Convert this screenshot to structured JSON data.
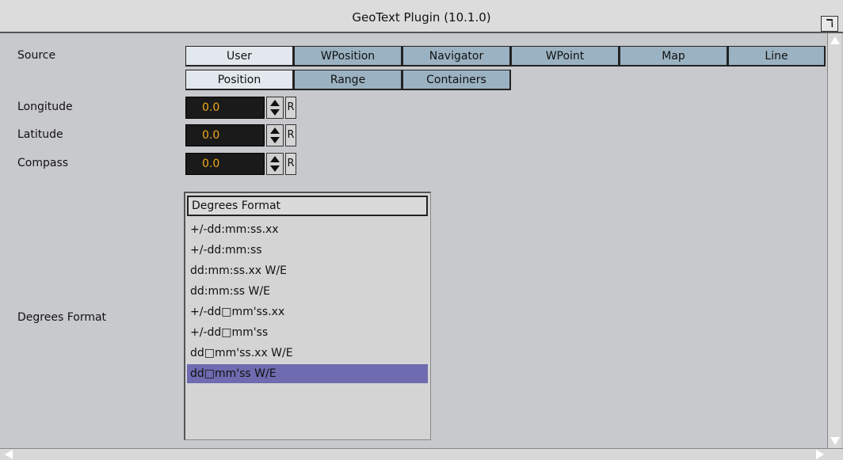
{
  "window": {
    "title": "GeoText Plugin (10.1.0)",
    "icon": "plugin-logo-icon"
  },
  "labels": {
    "source": "Source",
    "longitude": "Longitude",
    "latitude": "Latitude",
    "compass": "Compass",
    "degrees_format": "Degrees Format"
  },
  "source_tabs": [
    {
      "label": "User",
      "active": true
    },
    {
      "label": "WPosition",
      "active": false
    },
    {
      "label": "Navigator",
      "active": false
    },
    {
      "label": "WPoint",
      "active": false
    },
    {
      "label": "Map",
      "active": false
    },
    {
      "label": "Line",
      "active": false
    }
  ],
  "sub_tabs": [
    {
      "label": "Position",
      "active": true
    },
    {
      "label": "Range",
      "active": false
    },
    {
      "label": "Containers",
      "active": false
    }
  ],
  "fields": {
    "longitude": {
      "value": "0.0",
      "reset": "R"
    },
    "latitude": {
      "value": "0.0",
      "reset": "R"
    },
    "compass": {
      "value": "0.0",
      "reset": "R"
    }
  },
  "degrees_list": {
    "header": "Degrees Format",
    "items": [
      "+/-dd:mm:ss.xx",
      "+/-dd:mm:ss",
      "dd:mm:ss.xx W/E",
      "dd:mm:ss W/E",
      "+/-dd□mm'ss.xx",
      "+/-dd□mm'ss",
      "dd□mm'ss.xx W/E",
      "dd□mm'ss W/E"
    ],
    "selected": "dd□mm'ss W/E"
  },
  "colors": {
    "background": "#c8c9cc",
    "tab": "#9bb2c2",
    "tab_active": "#e3e8ee",
    "field_bg": "#1a1a1a",
    "field_text": "#f0a818",
    "selection": "#6f6bb0"
  }
}
